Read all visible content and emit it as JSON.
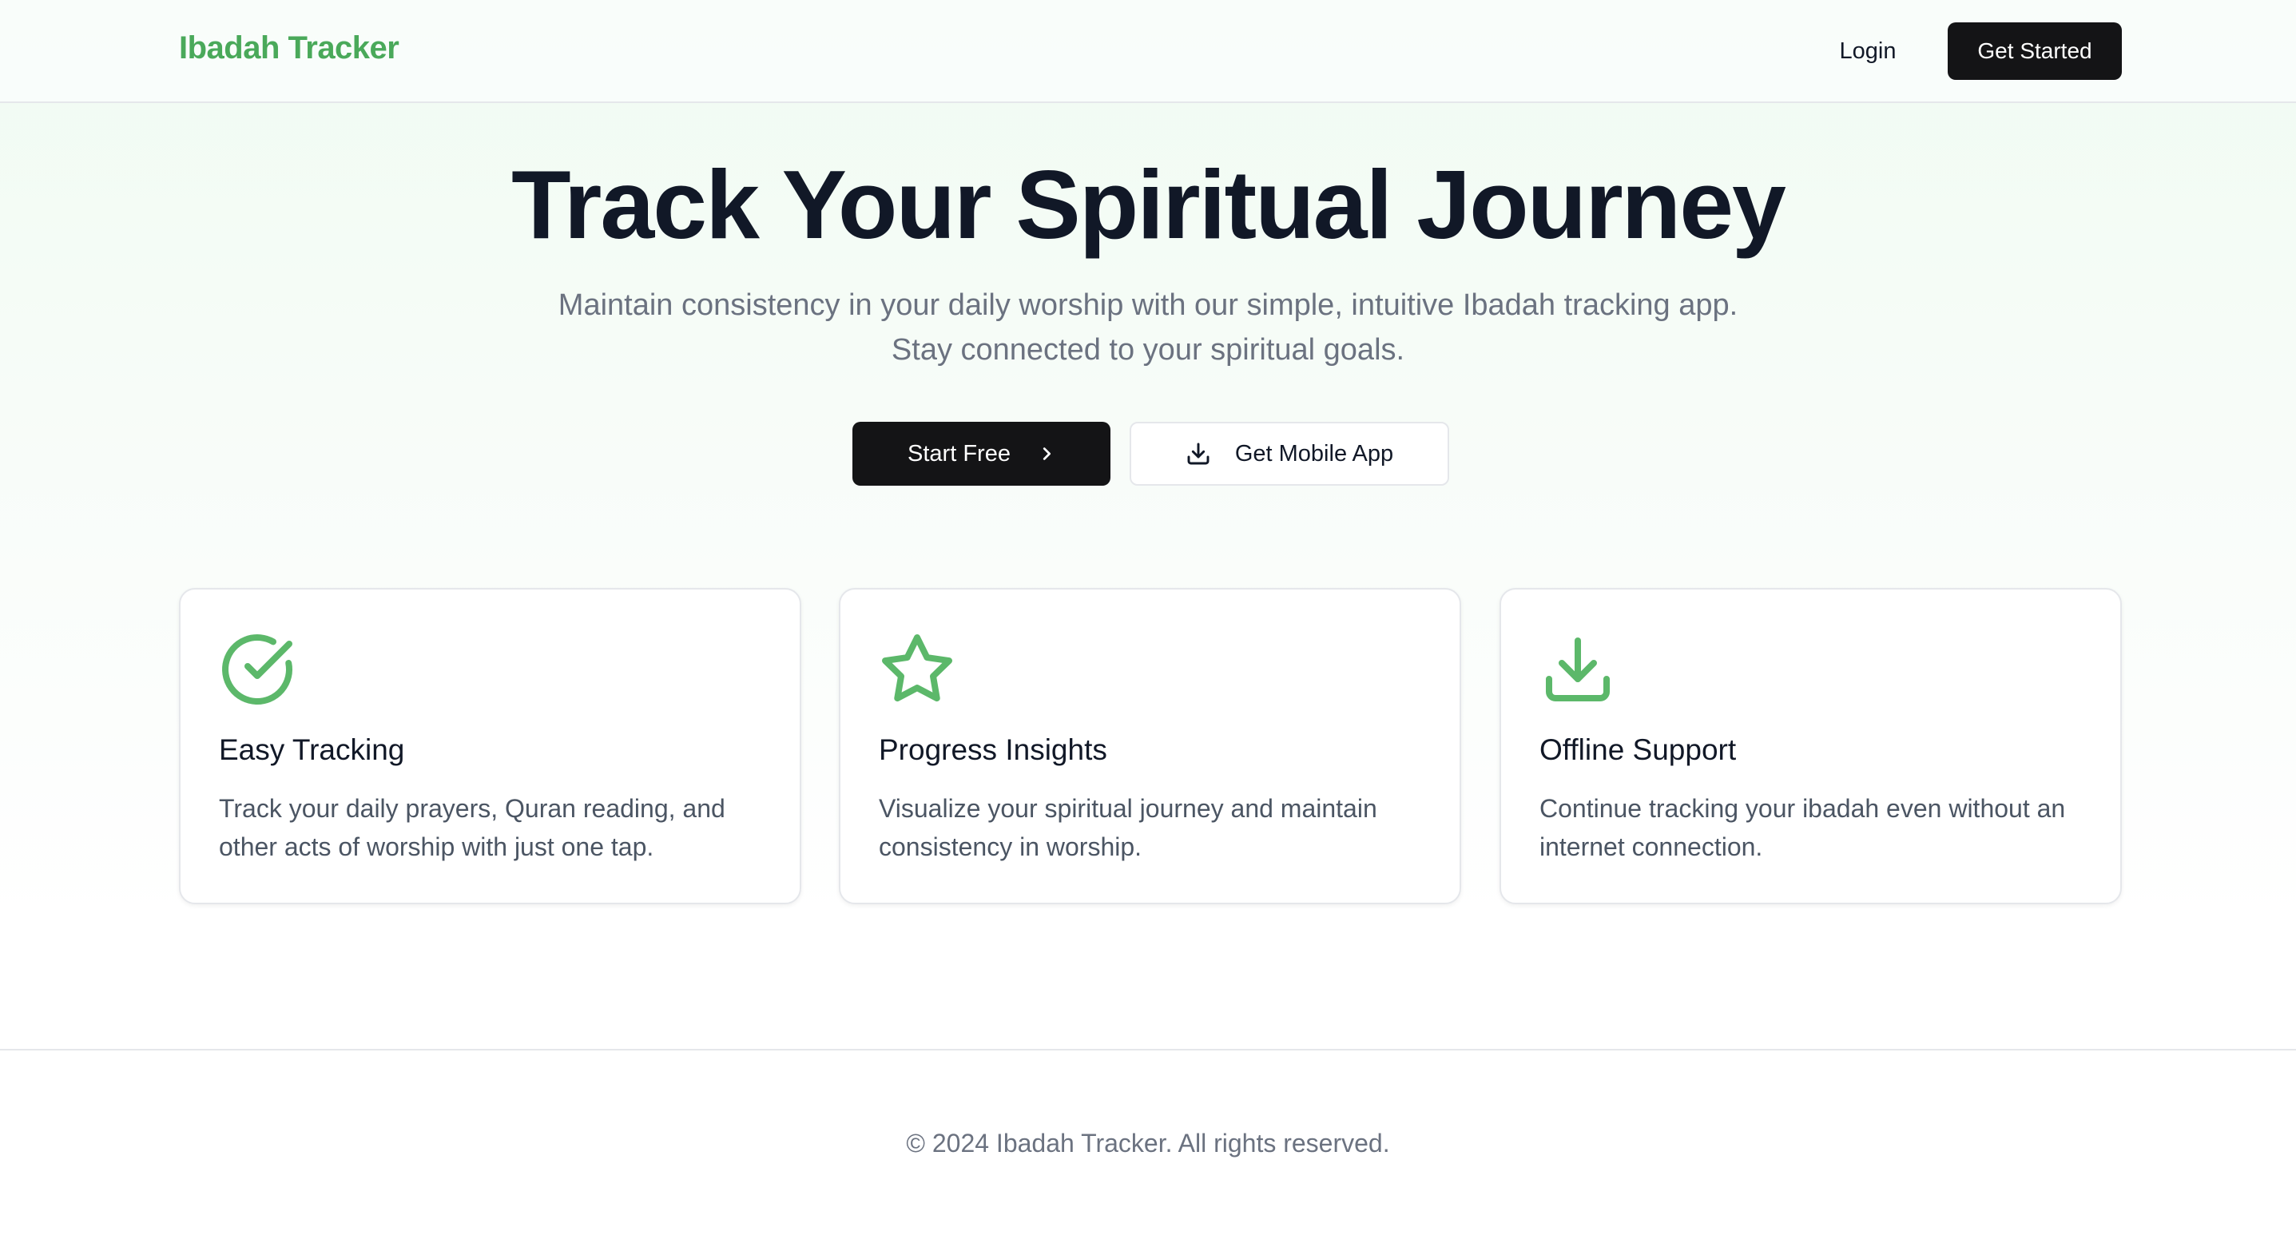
{
  "nav": {
    "brand": "Ibadah Tracker",
    "login_label": "Login",
    "cta_label": "Get Started"
  },
  "hero": {
    "title": "Track Your Spiritual Journey",
    "subtitle_line1": "Maintain consistency in your daily worship with our simple, intuitive Ibadah tracking app.",
    "subtitle_line2": "Stay connected to your spiritual goals.",
    "primary_button": "Start Free",
    "primary_icon": "chevron-right-icon",
    "secondary_button": "Get Mobile App",
    "secondary_icon": "download-icon"
  },
  "features": [
    {
      "icon": "check-circle-icon",
      "title": "Easy Tracking",
      "description": "Track your daily prayers, Quran reading, and other acts of worship with just one tap."
    },
    {
      "icon": "star-icon",
      "title": "Progress Insights",
      "description": "Visualize your spiritual journey and maintain consistency in worship."
    },
    {
      "icon": "download-icon",
      "title": "Offline Support",
      "description": "Continue tracking your ibadah even without an internet connection."
    }
  ],
  "footer": {
    "copyright": "© 2024 Ibadah Tracker. All rights reserved."
  },
  "colors": {
    "accent": "#4aa95a",
    "icon_green": "#5cb86a",
    "primary_button": "#141416",
    "heading": "#111827",
    "muted_text": "#6b7280"
  }
}
